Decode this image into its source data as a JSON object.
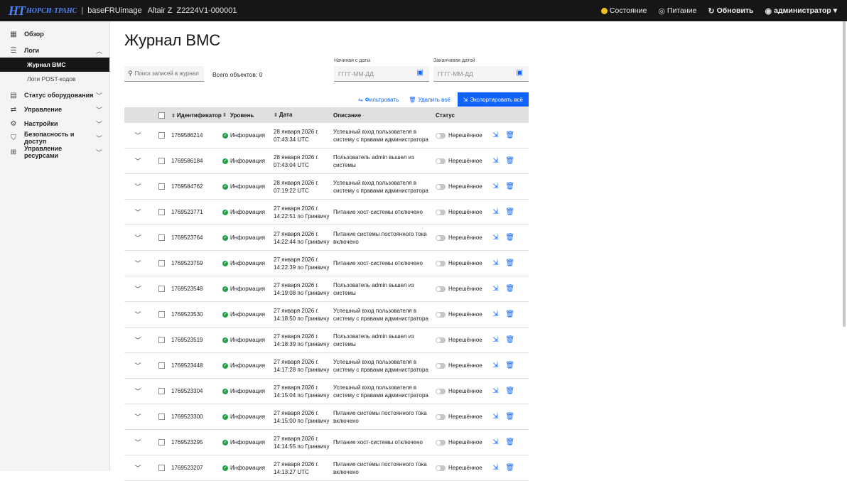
{
  "topbar": {
    "logo_mark": "НТ",
    "logo_text": "НОРСИ-ТРАНС",
    "separator": "|",
    "host": "baseFRUimage",
    "model": "Altair Z",
    "serial": "Z2224V1-000001",
    "status_label": "Состояние",
    "power_label": "Питание",
    "refresh_label": "Обновить",
    "user_label": "администратор"
  },
  "sidebar": {
    "items": [
      {
        "label": "Обзор",
        "icon": "dashboard-icon"
      },
      {
        "label": "Логи",
        "icon": "logs-icon"
      },
      {
        "label": "Журнал BMC",
        "active": true
      },
      {
        "label": "Логи POST-кодов"
      },
      {
        "label": "Статус оборудования",
        "icon": "hardware-icon"
      },
      {
        "label": "Управление",
        "icon": "control-icon"
      },
      {
        "label": "Настройки",
        "icon": "settings-icon"
      },
      {
        "label": "Безопасность и доступ",
        "icon": "security-icon"
      },
      {
        "label": "Управление ресурсами",
        "icon": "resources-icon"
      }
    ]
  },
  "page": {
    "title": "Журнал BMC",
    "search_placeholder": "Поиск записей в журнал",
    "total": "Всего объектов: 0",
    "from_label": "Начиная с даты",
    "to_label": "Заканчивая датой",
    "date_placeholder": "ГГГГ-ММ-ДД",
    "filter_label": "Фильтровать",
    "delete_all_label": "Удалить всё",
    "export_all_label": "Экспортировать всё"
  },
  "table": {
    "headers": [
      "Идентификатор",
      "Уровень",
      "Дата",
      "Описание",
      "Статус"
    ],
    "rows": [
      {
        "id": "1769586214",
        "level": "Информация",
        "date1": "28 января 2026 г.",
        "date2": "07:43:34 UTC",
        "desc1": "Успешный вход пользователя в",
        "desc2": "систему с правами администратора",
        "status": "Нерешённое"
      },
      {
        "id": "1769586184",
        "level": "Информация",
        "date1": "28 января 2026 г.",
        "date2": "07:43:04 UTC",
        "desc1": "Пользователь admin вышел из",
        "desc2": "системы",
        "status": "Нерешённое"
      },
      {
        "id": "1769584762",
        "level": "Информация",
        "date1": "28 января 2026 г.",
        "date2": "07:19:22 UTC",
        "desc1": "Успешный вход пользователя в",
        "desc2": "систему с правами администратора",
        "status": "Нерешённое"
      },
      {
        "id": "1769523771",
        "level": "Информация",
        "date1": "27 января 2026 г.",
        "date2": "14:22:51 по Гринвичу",
        "desc1": "Питание хост-системы отключено",
        "desc2": "",
        "status": "Нерешённое"
      },
      {
        "id": "1769523764",
        "level": "Информация",
        "date1": "27 января 2026 г.",
        "date2": "14:22:44 по Гринвичу",
        "desc1": "Питание системы постоянного тока",
        "desc2": "включено",
        "status": "Нерешённое"
      },
      {
        "id": "1769523759",
        "level": "Информация",
        "date1": "27 января 2026 г.",
        "date2": "14:22:39 по Гринвичу",
        "desc1": "Питание хост-системы отключено",
        "desc2": "",
        "status": "Нерешённое"
      },
      {
        "id": "1769523548",
        "level": "Информация",
        "date1": "27 января 2026 г.",
        "date2": "14:19:08 по Гринвичу",
        "desc1": "Пользователь admin вышел из",
        "desc2": "системы",
        "status": "Нерешённое"
      },
      {
        "id": "1769523530",
        "level": "Информация",
        "date1": "27 января 2026 г.",
        "date2": "14:18:50 по Гринвичу",
        "desc1": "Успешный вход пользователя в",
        "desc2": "систему с правами администратора",
        "status": "Нерешённое"
      },
      {
        "id": "1769523519",
        "level": "Информация",
        "date1": "27 января 2026 г.",
        "date2": "14:18:39 по Гринвичу",
        "desc1": "Пользователь admin вышел из",
        "desc2": "системы",
        "status": "Нерешённое"
      },
      {
        "id": "1769523448",
        "level": "Информация",
        "date1": "27 января 2026 г.",
        "date2": "14:17:28 по Гринвичу",
        "desc1": "Успешный вход пользователя в",
        "desc2": "систему с правами администратора",
        "status": "Нерешённое"
      },
      {
        "id": "1769523304",
        "level": "Информация",
        "date1": "27 января 2026 г.",
        "date2": "14:15:04 по Гринвичу",
        "desc1": "Успешный вход пользователя в",
        "desc2": "систему с правами администратора",
        "status": "Нерешённое"
      },
      {
        "id": "1769523300",
        "level": "Информация",
        "date1": "27 января 2026 г.",
        "date2": "14:15:00 по Гринвичу",
        "desc1": "Питание системы постоянного тока",
        "desc2": "включено",
        "status": "Нерешённое"
      },
      {
        "id": "1769523295",
        "level": "Информация",
        "date1": "27 января 2026 г.",
        "date2": "14:14:55 по Гринвичу",
        "desc1": "Питание хост-системы отключено",
        "desc2": "",
        "status": "Нерешённое"
      },
      {
        "id": "1769523207",
        "level": "Информация",
        "date1": "27 января 2026 г.",
        "date2": "14:13:27 UTC",
        "desc1": "Питание системы постоянного тока",
        "desc2": "включено",
        "status": "Нерешённое"
      }
    ]
  },
  "colors": {
    "accent": "#0f62fe",
    "topbar": "#161616",
    "success": "#24a148",
    "warning": "#f1c21b"
  }
}
